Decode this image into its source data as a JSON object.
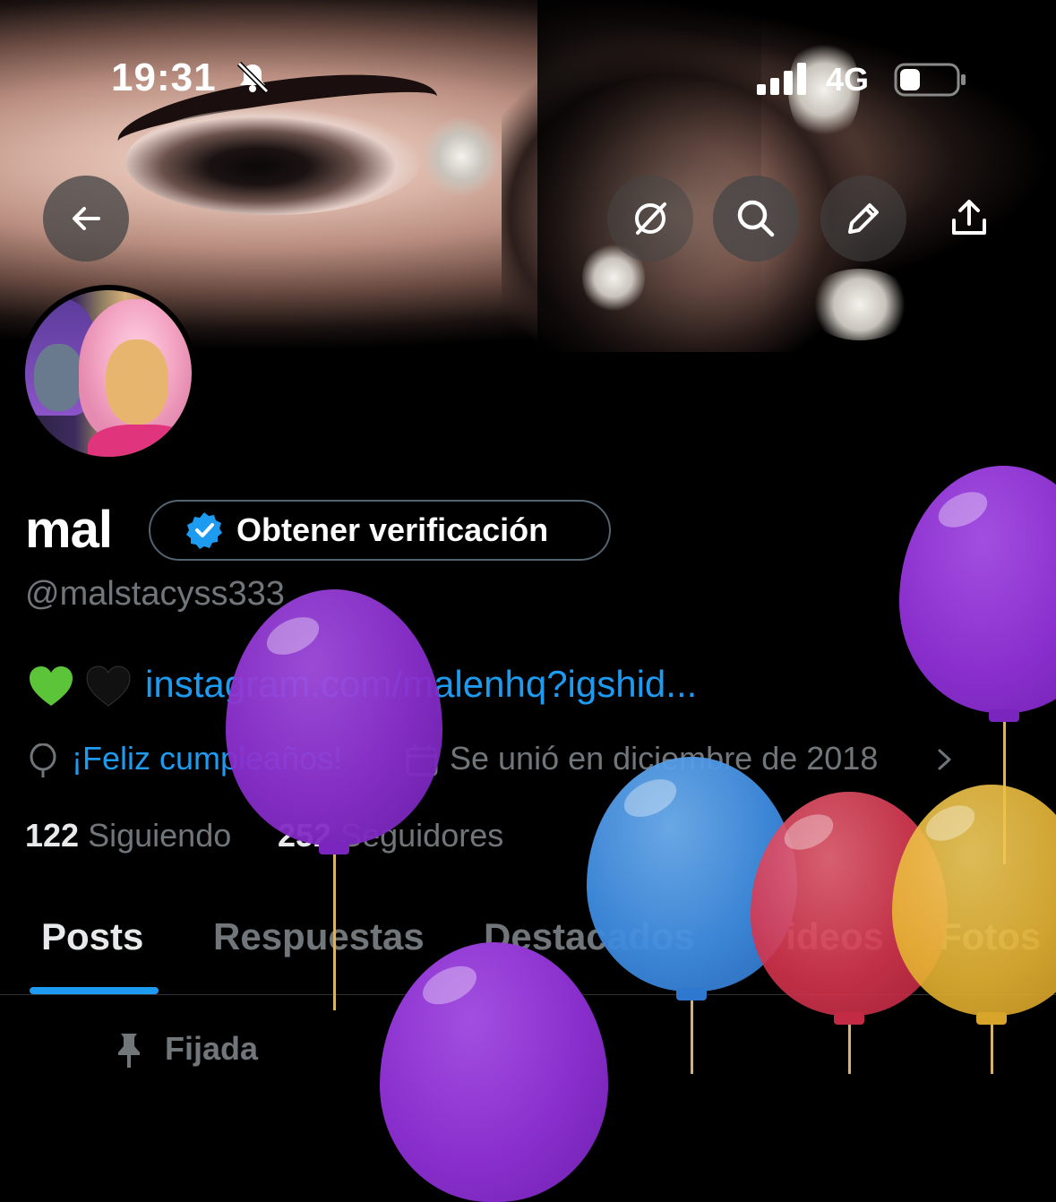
{
  "status_bar": {
    "time": "19:31",
    "network": "4G",
    "icons": [
      "bell-slash-icon",
      "signal-bars-icon",
      "battery-icon"
    ]
  },
  "header": {
    "buttons": [
      "back-arrow-icon",
      "grok-icon",
      "search-icon",
      "pencil-icon",
      "share-icon"
    ]
  },
  "profile": {
    "display_name": "mal",
    "verify_button_label": "Obtener verificación",
    "handle": "@malstacyss333",
    "bio_emojis": [
      "💚",
      "🖤"
    ],
    "bio_link": "instagram.com/malenhq?igshid...",
    "birthday": "¡Feliz cumpleaños!",
    "joined": "Se unió en diciembre de 2018",
    "following_count": "122",
    "following_label": "Siguiendo",
    "followers_count": "252",
    "followers_label": "Seguidores"
  },
  "tabs": [
    "Posts",
    "Respuestas",
    "Destacados",
    "Videos",
    "Fotos"
  ],
  "active_tab": "Posts",
  "pinned_label": "Fijada",
  "colors": {
    "accent": "#1d9bf0",
    "muted": "#71767b",
    "balloon_purple": "#8e2fcf",
    "balloon_blue": "#3f8ce0",
    "balloon_red": "#d6364f",
    "balloon_yellow": "#e7b534"
  }
}
